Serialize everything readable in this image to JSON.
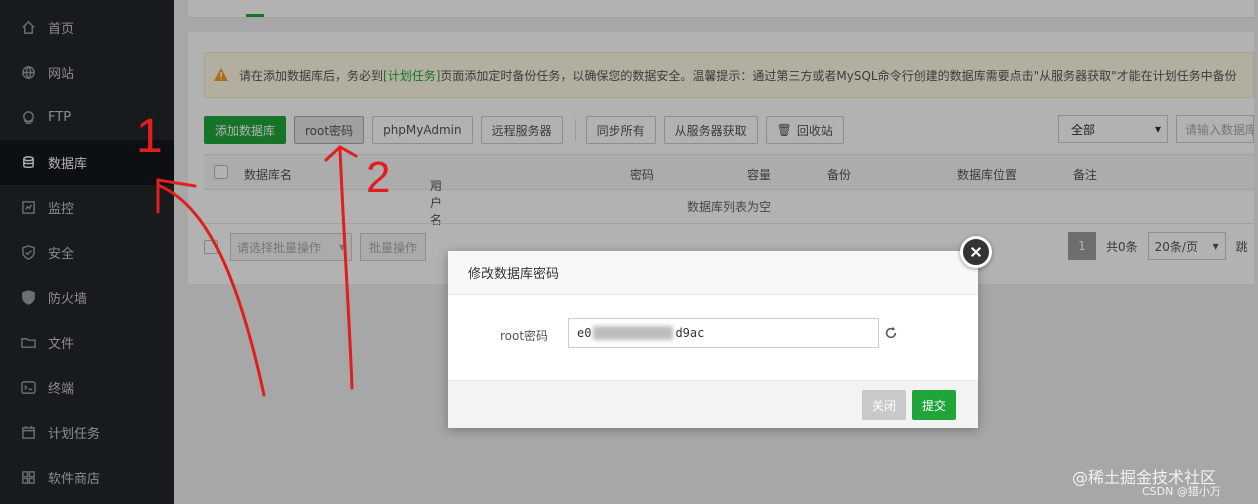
{
  "sidebar": {
    "items": [
      {
        "label": "首页",
        "icon": "home-icon"
      },
      {
        "label": "网站",
        "icon": "globe-icon"
      },
      {
        "label": "FTP",
        "icon": "ftp-icon"
      },
      {
        "label": "数据库",
        "icon": "database-icon",
        "active": true
      },
      {
        "label": "监控",
        "icon": "monitor-icon"
      },
      {
        "label": "安全",
        "icon": "shield-icon"
      },
      {
        "label": "防火墙",
        "icon": "firewall-icon"
      },
      {
        "label": "文件",
        "icon": "folder-icon"
      },
      {
        "label": "终端",
        "icon": "terminal-icon"
      },
      {
        "label": "计划任务",
        "icon": "calendar-icon"
      },
      {
        "label": "软件商店",
        "icon": "store-icon"
      }
    ]
  },
  "notice": {
    "prefix": "请在添加数据库后，务必到",
    "link": "[计划任务]",
    "suffix": "页面添加定时备份任务，以确保您的数据安全。温馨提示：通过第三方或者MySQL命令行创建的数据库需要点击\"从服务器获取\"才能在计划任务中备份"
  },
  "toolbar": {
    "add_db": "添加数据库",
    "root_pwd": "root密码",
    "phpmyadmin": "phpMyAdmin",
    "remote_server": "远程服务器",
    "sync_all": "同步所有",
    "fetch_from_server": "从服务器获取",
    "recycle_bin": "回收站"
  },
  "filter": {
    "selected": "全部"
  },
  "search": {
    "placeholder": "请输入数据库名"
  },
  "table": {
    "headers": [
      "数据库名",
      "用户名",
      "密码",
      "容量",
      "备份",
      "数据库位置",
      "备注"
    ],
    "empty": "数据库列表为空"
  },
  "batch": {
    "placeholder": "请选择批量操作",
    "button": "批量操作"
  },
  "pager": {
    "current": "1",
    "total": "共0条",
    "page_size": "20条/页",
    "jump": "跳"
  },
  "modal": {
    "title": "修改数据库密码",
    "field_label": "root密码",
    "value_start": "e0",
    "value_end": "d9ac",
    "close": "关闭",
    "submit": "提交"
  },
  "annotations": {
    "one": "1",
    "two": "2"
  },
  "watermark": {
    "line1": "@稀土掘金技术社区",
    "line2": "CSDN @猎小万"
  },
  "colors": {
    "accent": "#20a53a",
    "sidebar": "#23272b",
    "annotation": "#e01e1e"
  }
}
